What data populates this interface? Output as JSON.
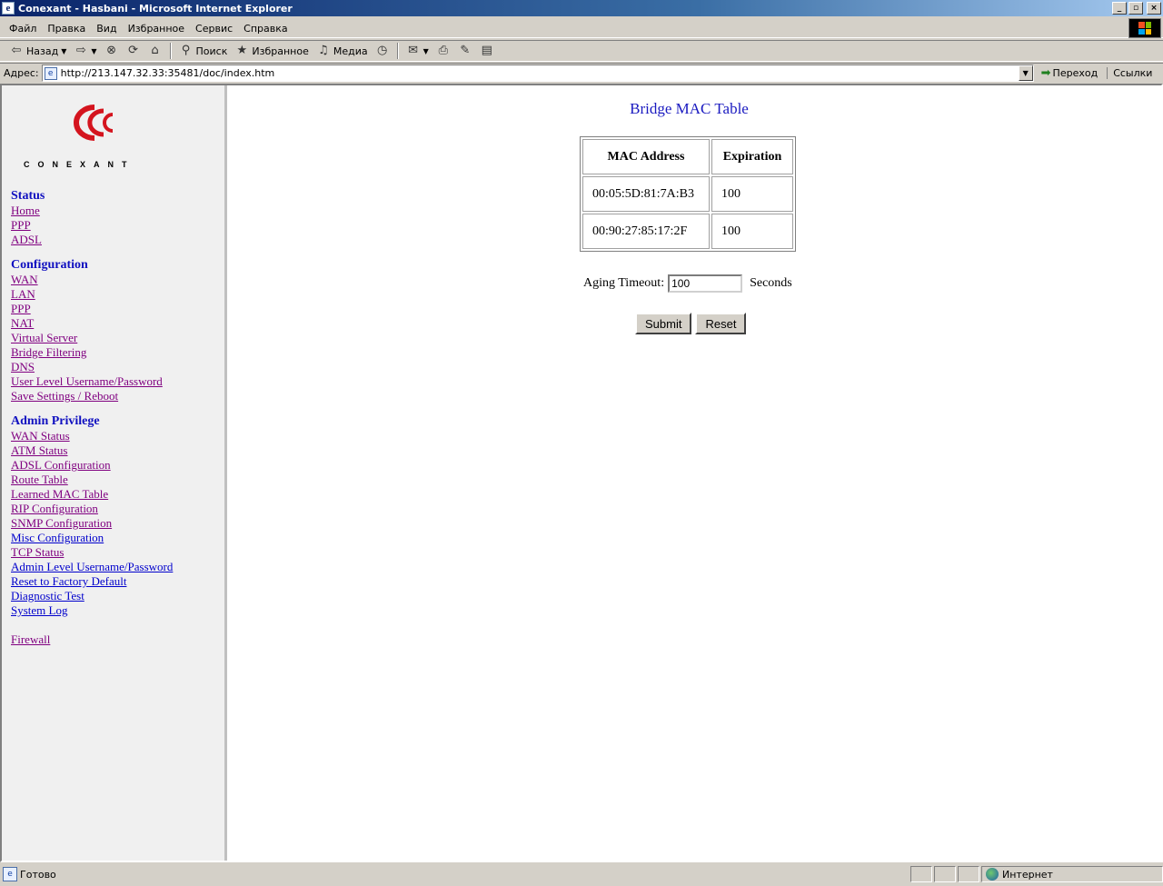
{
  "window": {
    "title": "Conexant - Hasbani - Microsoft Internet Explorer",
    "controls": {
      "minimize": "_",
      "maximize": "▫",
      "close": "×"
    }
  },
  "menu": [
    "Файл",
    "Правка",
    "Вид",
    "Избранное",
    "Сервис",
    "Справка"
  ],
  "toolbar": {
    "back": "Назад",
    "search": "Поиск",
    "favorites": "Избранное",
    "media": "Медиа"
  },
  "address": {
    "label": "Адрес:",
    "url": "http://213.147.32.33:35481/doc/index.htm",
    "go": "Переход",
    "links": "Ссылки"
  },
  "sidebar": {
    "logo_text": "CONEXANT",
    "sections": [
      {
        "heading": "Status",
        "links": [
          "Home",
          "PPP",
          "ADSL"
        ]
      },
      {
        "heading": "Configuration",
        "links": [
          "WAN",
          "LAN",
          "PPP",
          "NAT",
          "Virtual Server",
          "Bridge Filtering",
          "DNS",
          "User Level Username/Password",
          "Save Settings / Reboot"
        ]
      },
      {
        "heading": "Admin Privilege",
        "links": [
          "WAN Status",
          "ATM Status",
          "ADSL Configuration",
          "Route Table",
          "Learned MAC Table",
          "RIP Configuration",
          "SNMP Configuration",
          "Misc Configuration",
          "TCP Status",
          "Admin Level Username/Password",
          "Reset to Factory Default",
          "Diagnostic Test",
          "System Log"
        ]
      },
      {
        "heading": "",
        "links": [
          "Firewall"
        ]
      }
    ]
  },
  "main": {
    "title": "Bridge MAC Table",
    "table": {
      "headers": [
        "MAC Address",
        "Expiration"
      ],
      "rows": [
        [
          "00:05:5D:81:7A:B3",
          "100"
        ],
        [
          "00:90:27:85:17:2F",
          "100"
        ]
      ]
    },
    "aging": {
      "label": "Aging Timeout:",
      "value": "100",
      "unit": "Seconds"
    },
    "buttons": {
      "submit": "Submit",
      "reset": "Reset"
    }
  },
  "status": {
    "text": "Готово",
    "zone": "Интернет"
  },
  "colors": {
    "heading_blue": "#1010c0",
    "visited_link": "#800080",
    "title_blue": "#1a1ac0",
    "logo_red": "#d4141e"
  }
}
